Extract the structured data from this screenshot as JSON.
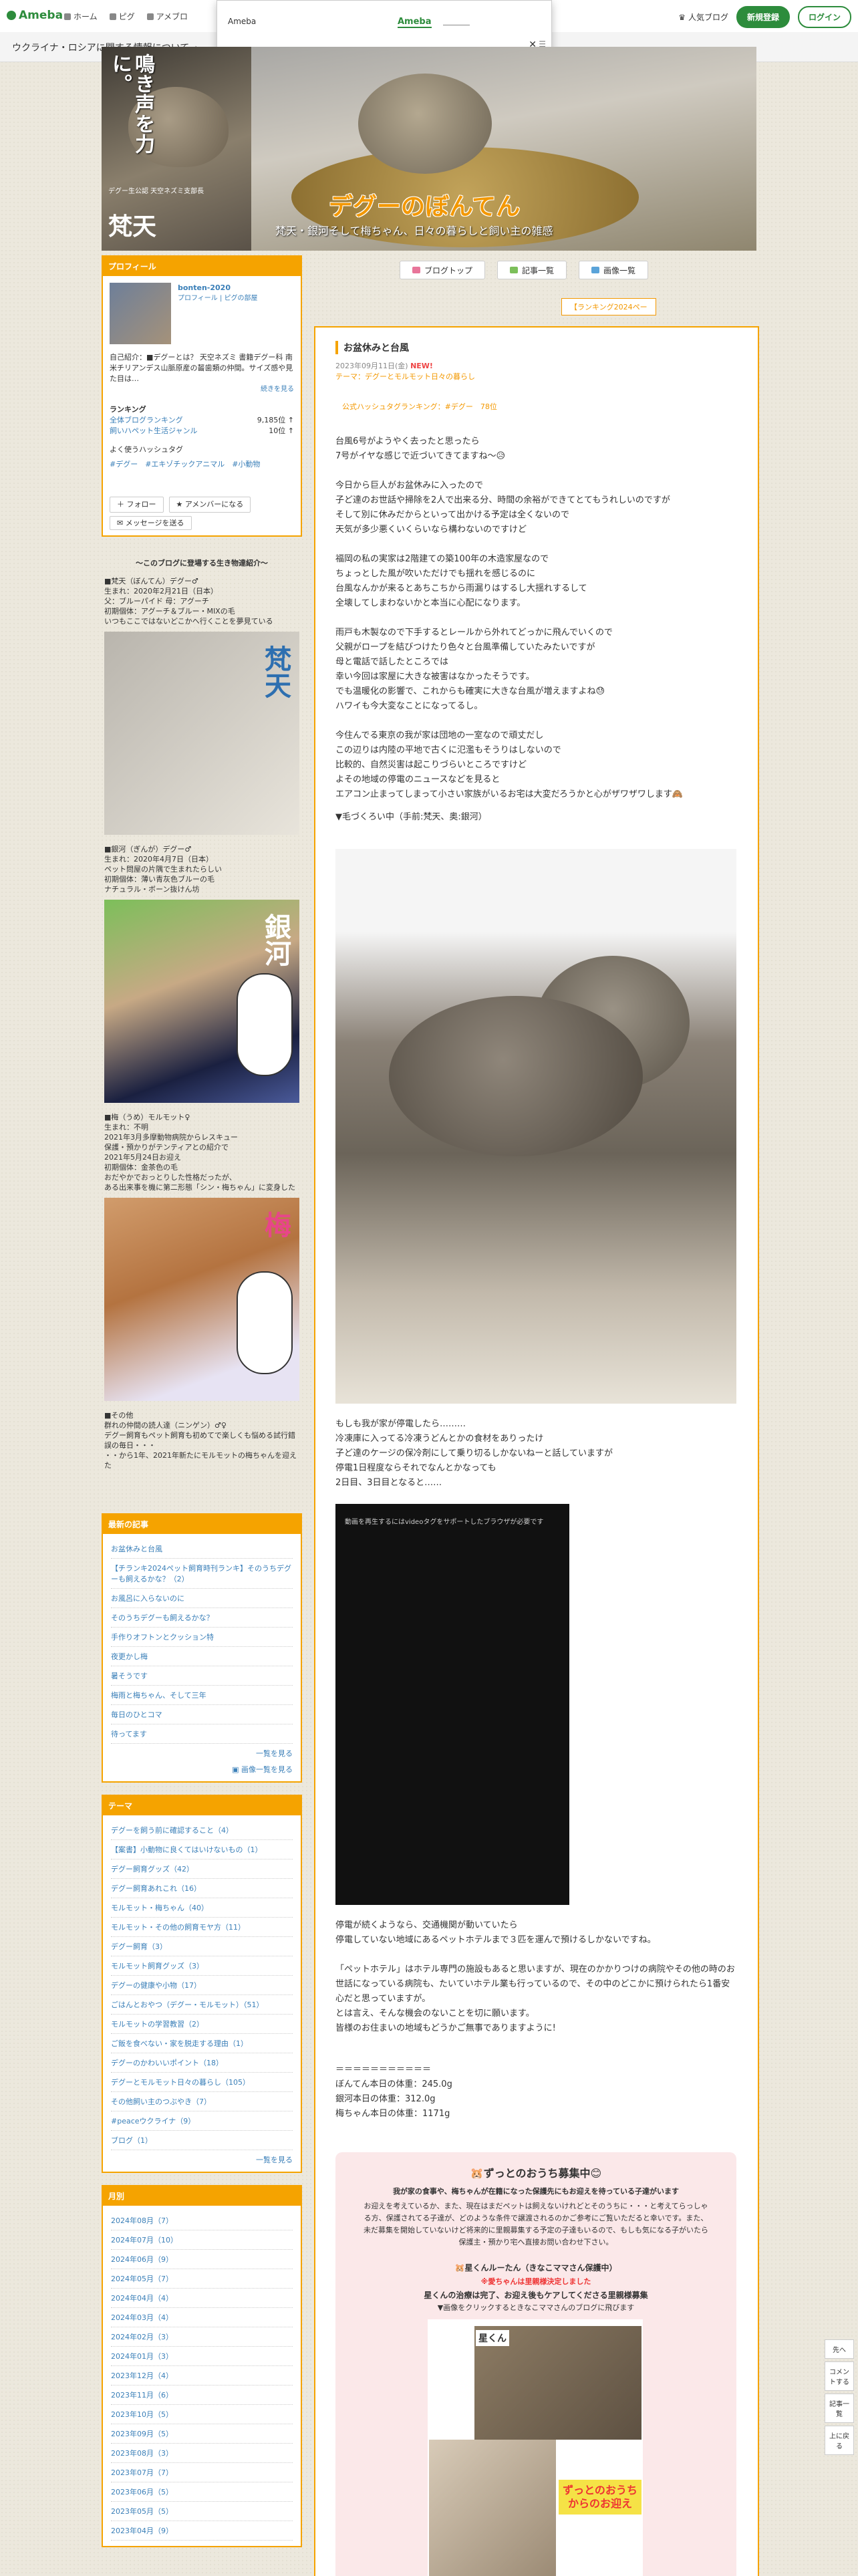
{
  "global_bar": {
    "logo": "Ameba",
    "nav": [
      "ホーム",
      "ピグ",
      "アメブロ"
    ],
    "popular": "人気ブログ",
    "signup": "新規登録",
    "login": "ログイン"
  },
  "ukraine_bar": "ウクライナ・ロシアに関する情報について",
  "dropdown": {
    "label": "Ameba",
    "selected": "Ameba",
    "close": "✕"
  },
  "header": {
    "vertical_text": "鳴き声を力に。",
    "sub_text": "デグー生公認 天空ネズミ支部長",
    "big_name": "梵天",
    "blog_title": "デグーのぼんてん",
    "blog_desc": "梵天・銀河そして梅ちゃん、日々の暮らしと飼い主の雑感"
  },
  "blog_nav": {
    "top": "ブログトップ",
    "entries": "記事一覧",
    "images": "画像一覧"
  },
  "rank_button": "【ランキング2024ペー",
  "sidebar": {
    "profile_header": "プロフィール",
    "profile_name": "bonten-2020",
    "profile_links": "プロフィール | ピグの部屋",
    "intro": "自己紹介：■デグーとは？ 天空ネズミ 書籍デグー科 南米チリアンデス山脈原産の齧歯類の仲間。サイズ感や見た目は…",
    "more": "続きを見る",
    "ranking_title": "ランキング",
    "rank1_label": "全体ブログランキング",
    "rank1_value": "9,185位 ↑",
    "rank2_label": "飼いハペット生活ジャンル",
    "rank2_value": "10位 ↑",
    "hashtags_title": "よく使うハッシュタグ",
    "hashtags": "#デグー　#エキゾチックアニマル　#小動物",
    "follow": "フォロー",
    "amember": "アメンバーになる",
    "message": "メッセージを送る",
    "intro_title": "〜このブログに登場する生き物達紹介〜",
    "bonten_text": "■梵天（ぼんてん）デグー♂\n生まれ：2020年2月21日（日本）\n父：ブルーパイド 母：アグーチ\n初期個体：アグーチ＆ブルー・MIXの毛\nいつもここではないどこかへ行くことを夢見ている",
    "bonten_caption": "梵天",
    "ginga_text": "■銀河（ぎんが）デグー♂\n生まれ：2020年4月7日（日本）\nペット問屋の片隅で生まれたらしい\n初期個体：薄い青灰色ブルーの毛\nナチュラル・ボーン抜けん坊",
    "ginga_caption": "銀河",
    "ume_text": "■梅（うめ）モルモット♀\n生まれ：不明\n2021年3月多摩動物病院からレスキュー\n保護・預かりがテンティアとの紹介で\n2021年5月24日お迎え\n初期個体：金茶色の毛\nおだやかでおっとりした性格だったが、\nある出来事を機に第二形態「シン・梅ちゃん」に変身した",
    "ume_caption": "梅",
    "other_text": "■その他\n群れの仲間の読人達（ニンゲン）♂♀\nデグー飼育もペット飼育も初めてで楽しくも悩める試行錯誤の毎日・・・\n・・から1年、2021年新たにモルモットの梅ちゃんを迎えた",
    "recent_header": "最新の記事",
    "recent": [
      "お盆休みと台風",
      "【チランキ2024ペット飼育時刊ランキ】そのうちデグーも飼えるかな？（2）",
      "お風呂に入らないのに",
      "そのうちデグーも飼えるかな？",
      "手作りオフトンとクッション特",
      "夜更かし梅",
      "暑そうです",
      "梅雨と梅ちゃん、そして三年",
      "毎日のひとコマ",
      "待ってます"
    ],
    "recent_more": "一覧を見る",
    "recent_images": "画像一覧を見る",
    "theme_header": "テーマ",
    "themes": [
      "デグーを飼う前に確認すること（4）",
      "【案書】小動物に良くてはいけないもの（1）",
      "デグー飼育グッズ（42）",
      "デグー飼育あれこれ（16）",
      "モルモット・梅ちゃん（40）",
      "モルモット・その他の飼育モヤ方（11）",
      "デグー飼育（3）",
      "モルモット飼育グッズ（3）",
      "デグーの健康や小物（17）",
      "ごはんとおやつ（デグー・モルモット）（51）",
      "モルモットの学習教習（2）",
      "ご飯を食べない・家を脱走する理由（1）",
      "デグーのかわいいポイント（18）",
      "デグーとモルモット日々の暮らし（105）",
      "その他飼い主のつぶやき（7）",
      "#peaceウクライナ（9）",
      "ブログ（1）"
    ],
    "theme_more": "一覧を見る",
    "month_header": "月別",
    "months": [
      "2024年08月（7）",
      "2024年07月（10）",
      "2024年06月（9）",
      "2024年05月（7）",
      "2024年04月（4）",
      "2024年03月（4）",
      "2024年02月（3）",
      "2024年01月（3）",
      "2023年12月（4）",
      "2023年11月（6）",
      "2023年10月（5）",
      "2023年09月（5）",
      "2023年08月（3）",
      "2023年07月（7）",
      "2023年06月（5）",
      "2023年05月（5）",
      "2023年04月（9）"
    ]
  },
  "article": {
    "title": "お盆休みと台風",
    "date": "2023年09月11日(金)",
    "new": "NEW!",
    "theme": "テーマ：デグーとモルモット日々の暮らし",
    "ranking": "公式ハッシュタグランキング：#デグー　78位",
    "para1": "台風6号がようやく去ったと思ったら\n7号がイヤな感じで近づいてきてますね〜😥",
    "para2": "今日から巨人がお盆休みに入ったので\n子ど達のお世話や掃除を2人で出来る分、時間の余裕ができてとてもうれしいのですが\nそして別に休みだからといって出かける予定は全くないので\n天気が多少悪くいくらいなら構わないのですけど",
    "para3": "福岡の私の実家は2階建ての築100年の木造家屋なので\nちょっとした風が吹いただけでも揺れを感じるのに\n台風なんかが来るとあちこちから雨漏りはするし大揺れするして\n全壊してしまわないかと本当に心配になります。",
    "para4": "雨戸も木製なので下手するとレールから外れてどっかに飛んでいくので\n父親がロープを結びつけたり色々と台風準備していたみたいですが\n母と電話で話したところでは\n幸い今回は家屋に大きな被害はなかったそうです。\nでも温暖化の影響で、これからも確実に大きな台風が増えますよね😓\nハワイも今大変なことになってるし。",
    "para5": "今住んでる東京の我が家は団地の一室なので頑丈だし\nこの辺りは内陸の平地で古くに氾濫もそうりはしないので\n比較的、自然災害は起こりづらいところですけど\nよその地域の停電のニュースなどを見ると",
    "para6": "エアコン止まってしまって小さい家族がいるお宅は大変だろうかと心がザワザワします🙈",
    "para7": "▼毛づくろい中（手前:梵天、奥:銀河）",
    "para8": "もしも我が家が停電したら………\n冷凍庫に入ってる冷凍うどんとかの食材をありったけ\n子ど達のケージの保冷剤にして乗り切るしかないねーと話していますが\n停電1日程度ならそれでなんとかなっても\n2日目、3日目となると……",
    "video_label": "動画を再生するにはvideoタグをサポートしたブラウザが必要です",
    "para9": "停電が続くようなら、交通機関が動いていたら\n停電していない地域にあるペットホテルまで３匹を運んで預けるしかないですね。",
    "para10": "「ペットホテル」はホテル専門の施設もあると思いますが、現在のかかりつけの病院やその他の時のお世話になっている病院も、たいていホテル業も行っているので、その中のどこかに預けられたら1番安心だと思っていますが。\nとは言え、そんな機会のないことを切に願います。\n皆様のお住まいの地域もどうかご無事でありますように!",
    "weights": "＝＝＝＝＝＝＝＝＝＝＝\nぼんてん本日の体重：245.0g\n銀河本日の体重：312.0g\n梅ちゃん本日の体重：1171g",
    "promo_title": "🐹ずっとのおうち募集中😊",
    "promo_sub": "我が家の食事や、梅ちゃんが在籍になった保護先にもお迎えを待っている子達がいます",
    "promo_body": "お迎えを考えているか、また、現在はまだペットは飼えないけれどとそのうちに・・・と考えてらっしゃる方、保護されてる子達が、どのような条件で譲渡されるのかご参考にご覧いただると幸いです。また、未だ募集を開始していないけど将来的に里親募集する予定の子達もいるので、もしも気になる子がいたら保護主・預かり宅へ直接お問い合わせ下さい。",
    "promo_name": "🐹星くんルーたん（きなこママさん保護中）",
    "promo_red": "※愛ちゃんは里親様決定しました",
    "promo_call": "星くんの治療は完了、お迎え後もケアしてくださる里親様募集",
    "promo_note": "▼画像をクリックするときなこママさんのブログに飛びます",
    "promo_img_name": "星くん",
    "promo_img_tag": "ずっとのおうちからのお迎え"
  },
  "floating": [
    "先へ",
    "コメントする",
    "記事一覧",
    "上に戻る"
  ]
}
